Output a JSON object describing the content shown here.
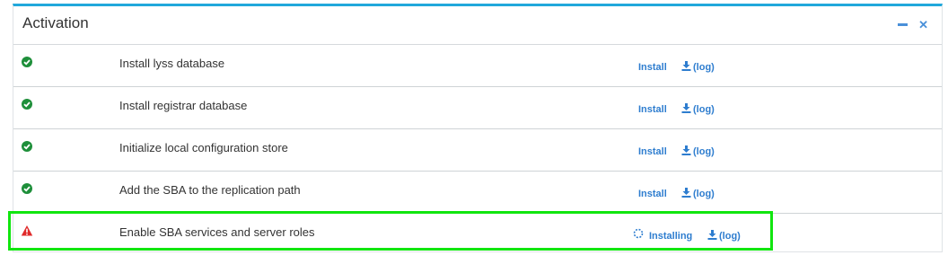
{
  "panel": {
    "title": "Activation",
    "minimize_icon": "minus-icon",
    "close_icon": "close-icon"
  },
  "colors": {
    "accent_border": "#22a8db",
    "success": "#1e8f3a",
    "warning": "#e02a2a",
    "link": "#2e7dcf",
    "highlight": "#11e60f"
  },
  "tasks": [
    {
      "label": "Install lyss database",
      "status": "success",
      "action": "Install",
      "log": "(log)"
    },
    {
      "label": "Install registrar database",
      "status": "success",
      "action": "Install",
      "log": "(log)"
    },
    {
      "label": "Initialize local configuration store",
      "status": "success",
      "action": "Install",
      "log": "(log)"
    },
    {
      "label": "Add the SBA to the replication path",
      "status": "success",
      "action": "Install",
      "log": "(log)"
    },
    {
      "label": "Enable SBA services and server roles",
      "status": "warning",
      "action": "Installing",
      "log": "(log)"
    }
  ]
}
